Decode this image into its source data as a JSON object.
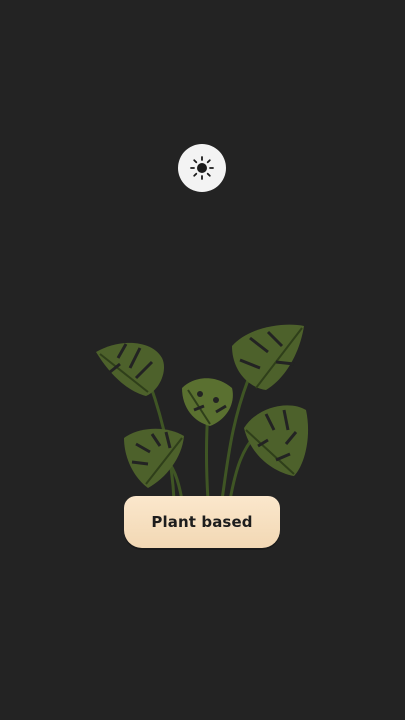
{
  "theme_toggle": {
    "icon": "sun-icon"
  },
  "plant": {
    "icon": "monstera-plant-illustration",
    "leaf_color": "#4a5e2a",
    "stem_color": "#3f5524"
  },
  "pot": {
    "label": "Plant based",
    "color": "#f6dfbf"
  }
}
